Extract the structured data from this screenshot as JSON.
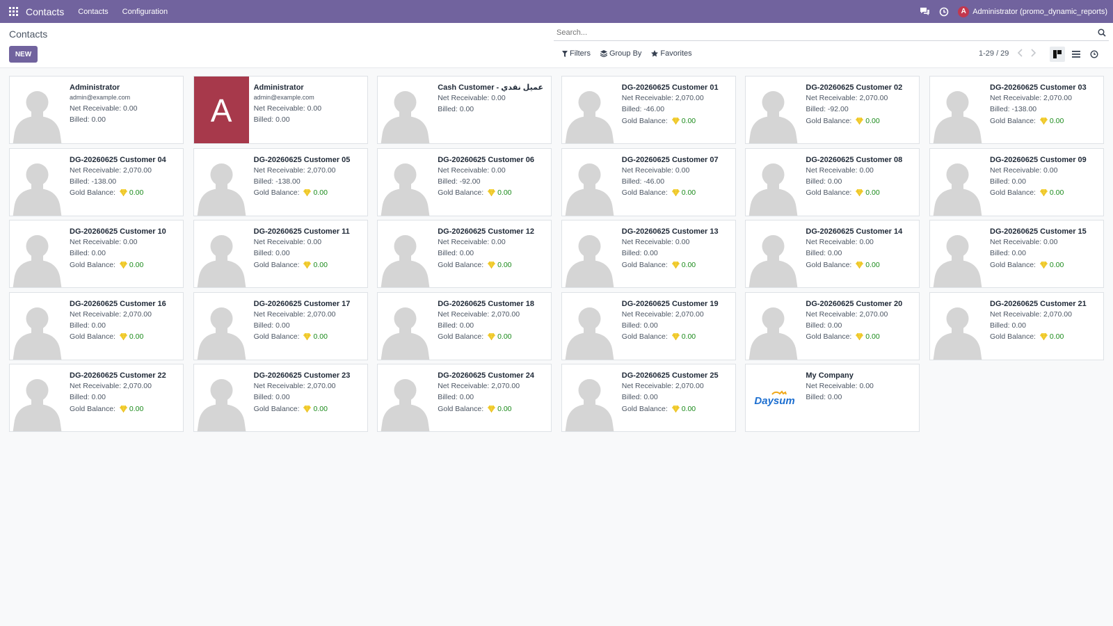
{
  "navbar": {
    "brand": "Contacts",
    "menu": [
      "Contacts",
      "Configuration"
    ],
    "user_initial": "A",
    "user_name": "Administrator (promo_dynamic_reports)",
    "icons": [
      "apps-grid-icon",
      "chat-icon",
      "clock-icon"
    ]
  },
  "control": {
    "title": "Contacts",
    "new_label": "NEW",
    "search_placeholder": "Search...",
    "filters_label": "Filters",
    "groupby_label": "Group By",
    "favorites_label": "Favorites",
    "pager": "1-29 / 29"
  },
  "labels": {
    "net": "Net Receivable: ",
    "billed": "Billed: ",
    "gold": "Gold Balance: "
  },
  "colors": {
    "navbar": "#71639e",
    "primary": "#71639e",
    "avatar_letter_bg": "#a7394b",
    "gold_value": "#1a8a1a",
    "gem": "#f5d33b"
  },
  "contacts": [
    {
      "name": "Administrator",
      "email": "admin@example.com",
      "net": "0.00",
      "billed": "0.00",
      "gold": null,
      "image": "silhouette"
    },
    {
      "name": "Administrator",
      "email": "admin@example.com",
      "net": "0.00",
      "billed": "0.00",
      "gold": null,
      "image": "letter",
      "letter": "A"
    },
    {
      "name": "Cash Customer - عميل نقدي",
      "email": null,
      "net": "0.00",
      "billed": "0.00",
      "gold": null,
      "image": "silhouette"
    },
    {
      "name": "DG-20260625 Customer 01",
      "email": null,
      "net": "2,070.00",
      "billed": "-46.00",
      "gold": "0.00",
      "image": "silhouette"
    },
    {
      "name": "DG-20260625 Customer 02",
      "email": null,
      "net": "2,070.00",
      "billed": "-92.00",
      "gold": "0.00",
      "image": "silhouette"
    },
    {
      "name": "DG-20260625 Customer 03",
      "email": null,
      "net": "2,070.00",
      "billed": "-138.00",
      "gold": "0.00",
      "image": "silhouette"
    },
    {
      "name": "DG-20260625 Customer 04",
      "email": null,
      "net": "2,070.00",
      "billed": "-138.00",
      "gold": "0.00",
      "image": "silhouette"
    },
    {
      "name": "DG-20260625 Customer 05",
      "email": null,
      "net": "2,070.00",
      "billed": "-138.00",
      "gold": "0.00",
      "image": "silhouette"
    },
    {
      "name": "DG-20260625 Customer 06",
      "email": null,
      "net": "0.00",
      "billed": "-92.00",
      "gold": "0.00",
      "image": "silhouette"
    },
    {
      "name": "DG-20260625 Customer 07",
      "email": null,
      "net": "0.00",
      "billed": "-46.00",
      "gold": "0.00",
      "image": "silhouette"
    },
    {
      "name": "DG-20260625 Customer 08",
      "email": null,
      "net": "0.00",
      "billed": "0.00",
      "gold": "0.00",
      "image": "silhouette"
    },
    {
      "name": "DG-20260625 Customer 09",
      "email": null,
      "net": "0.00",
      "billed": "0.00",
      "gold": "0.00",
      "image": "silhouette"
    },
    {
      "name": "DG-20260625 Customer 10",
      "email": null,
      "net": "0.00",
      "billed": "0.00",
      "gold": "0.00",
      "image": "silhouette"
    },
    {
      "name": "DG-20260625 Customer 11",
      "email": null,
      "net": "0.00",
      "billed": "0.00",
      "gold": "0.00",
      "image": "silhouette"
    },
    {
      "name": "DG-20260625 Customer 12",
      "email": null,
      "net": "0.00",
      "billed": "0.00",
      "gold": "0.00",
      "image": "silhouette"
    },
    {
      "name": "DG-20260625 Customer 13",
      "email": null,
      "net": "0.00",
      "billed": "0.00",
      "gold": "0.00",
      "image": "silhouette"
    },
    {
      "name": "DG-20260625 Customer 14",
      "email": null,
      "net": "0.00",
      "billed": "0.00",
      "gold": "0.00",
      "image": "silhouette"
    },
    {
      "name": "DG-20260625 Customer 15",
      "email": null,
      "net": "0.00",
      "billed": "0.00",
      "gold": "0.00",
      "image": "silhouette"
    },
    {
      "name": "DG-20260625 Customer 16",
      "email": null,
      "net": "2,070.00",
      "billed": "0.00",
      "gold": "0.00",
      "image": "silhouette"
    },
    {
      "name": "DG-20260625 Customer 17",
      "email": null,
      "net": "2,070.00",
      "billed": "0.00",
      "gold": "0.00",
      "image": "silhouette"
    },
    {
      "name": "DG-20260625 Customer 18",
      "email": null,
      "net": "2,070.00",
      "billed": "0.00",
      "gold": "0.00",
      "image": "silhouette"
    },
    {
      "name": "DG-20260625 Customer 19",
      "email": null,
      "net": "2,070.00",
      "billed": "0.00",
      "gold": "0.00",
      "image": "silhouette"
    },
    {
      "name": "DG-20260625 Customer 20",
      "email": null,
      "net": "2,070.00",
      "billed": "0.00",
      "gold": "0.00",
      "image": "silhouette"
    },
    {
      "name": "DG-20260625 Customer 21",
      "email": null,
      "net": "2,070.00",
      "billed": "0.00",
      "gold": "0.00",
      "image": "silhouette"
    },
    {
      "name": "DG-20260625 Customer 22",
      "email": null,
      "net": "2,070.00",
      "billed": "0.00",
      "gold": "0.00",
      "image": "silhouette"
    },
    {
      "name": "DG-20260625 Customer 23",
      "email": null,
      "net": "2,070.00",
      "billed": "0.00",
      "gold": "0.00",
      "image": "silhouette"
    },
    {
      "name": "DG-20260625 Customer 24",
      "email": null,
      "net": "2,070.00",
      "billed": "0.00",
      "gold": "0.00",
      "image": "silhouette"
    },
    {
      "name": "DG-20260625 Customer 25",
      "email": null,
      "net": "2,070.00",
      "billed": "0.00",
      "gold": "0.00",
      "image": "silhouette"
    },
    {
      "name": "My Company",
      "email": null,
      "net": "0.00",
      "billed": "0.00",
      "gold": null,
      "image": "logo",
      "logo_text": "Daysum"
    }
  ]
}
